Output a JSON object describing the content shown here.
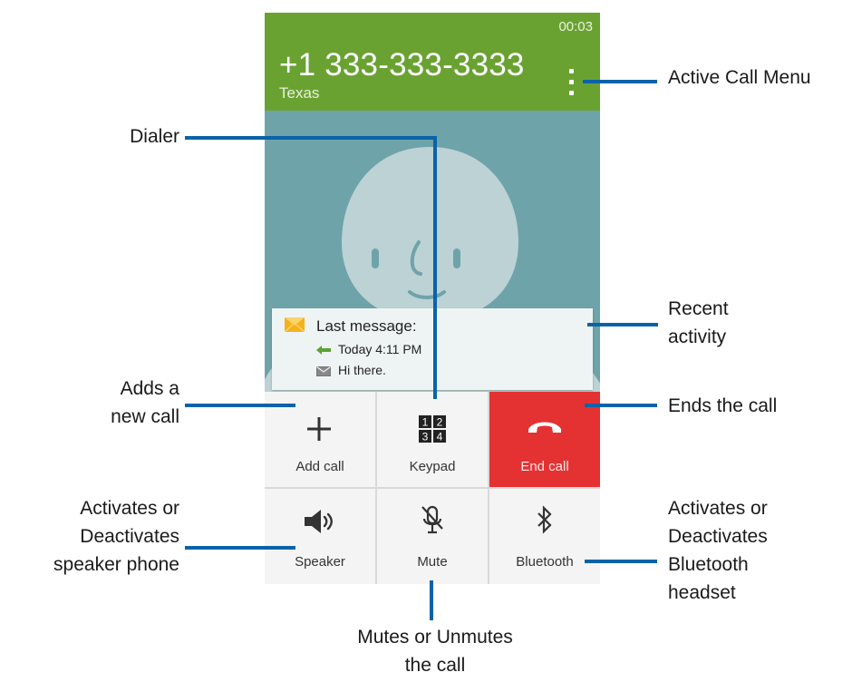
{
  "call": {
    "timer": "00:03",
    "number": "+1 333-333-3333",
    "location": "Texas"
  },
  "recent_activity": {
    "title": "Last message:",
    "time": "Today 4:11 PM",
    "message": "Hi there."
  },
  "buttons": {
    "add_call": "Add call",
    "keypad": "Keypad",
    "keypad_digits": [
      "1",
      "2",
      "3",
      "4"
    ],
    "end_call": "End call",
    "speaker": "Speaker",
    "mute": "Mute",
    "bluetooth": "Bluetooth"
  },
  "callouts": {
    "active_call_menu": "Active Call Menu",
    "dialer": "Dialer",
    "recent_activity_1": "Recent",
    "recent_activity_2": "activity",
    "adds_call_1": "Adds a",
    "adds_call_2": "new call",
    "ends_call": "Ends the call",
    "speaker_1": "Activates or",
    "speaker_2": "Deactivates",
    "speaker_3": "speaker phone",
    "bluetooth_1": "Activates or",
    "bluetooth_2": "Deactivates",
    "bluetooth_3": "Bluetooth",
    "bluetooth_4": "headset",
    "mute_1": "Mutes or Unmutes",
    "mute_2": "the call"
  },
  "colors": {
    "header": "#6aa232",
    "photo_background": "#6fa3aa",
    "end_call": "#e43233",
    "callout_line": "#0b62a8"
  }
}
